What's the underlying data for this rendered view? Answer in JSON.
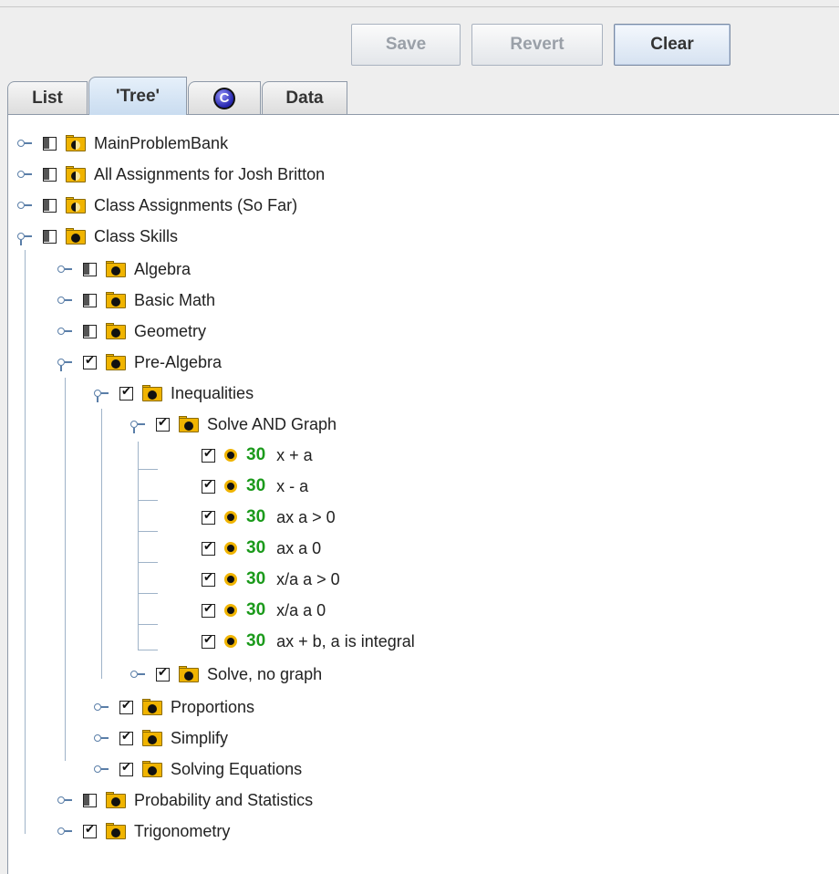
{
  "toolbar": {
    "save_label": "Save",
    "revert_label": "Revert",
    "clear_label": "Clear"
  },
  "tabs": [
    {
      "label": "List"
    },
    {
      "label": "'Tree'"
    },
    {
      "label": "C"
    },
    {
      "label": "Data"
    }
  ],
  "tree": {
    "main_problem_bank": "MainProblemBank",
    "all_assignments": "All Assignments for Josh Britton",
    "class_assignments": "Class Assignments (So Far)",
    "class_skills": "Class Skills",
    "algebra": "Algebra",
    "basic_math": "Basic Math",
    "geometry": "Geometry",
    "pre_algebra": "Pre-Algebra",
    "inequalities": "Inequalities",
    "solve_and_graph": "Solve AND Graph",
    "leaves": [
      {
        "score": "30",
        "label": "x + a"
      },
      {
        "score": "30",
        "label": "x - a"
      },
      {
        "score": "30",
        "label": "ax a > 0"
      },
      {
        "score": "30",
        "label": "ax a 0"
      },
      {
        "score": "30",
        "label": "x/a a > 0"
      },
      {
        "score": "30",
        "label": "x/a a 0"
      },
      {
        "score": "30",
        "label": "ax + b, a is integral"
      }
    ],
    "solve_no_graph": "Solve, no graph",
    "proportions": "Proportions",
    "simplify": "Simplify",
    "solving_equations": "Solving Equations",
    "probability_statistics": "Probability and Statistics",
    "trigonometry": "Trigonometry"
  }
}
